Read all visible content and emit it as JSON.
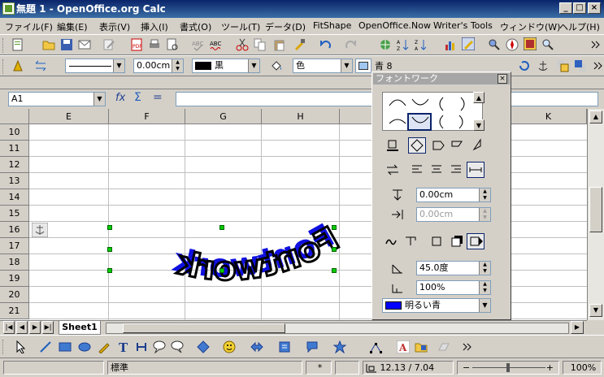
{
  "window": {
    "title": "無題 1 - OpenOffice.org Calc"
  },
  "menu": [
    "ファイル(F)",
    "編集(E)",
    "表示(V)",
    "挿入(I)",
    "書式(O)",
    "ツール(T)",
    "データ(D)",
    "FitShape",
    "OpenOffice.Now",
    "Writer's Tools",
    "ウィンドウ(W)",
    "ヘルプ(H)"
  ],
  "format_toolbar": {
    "line_width": "0.00cm",
    "line_color": "黒",
    "area_mode": "色",
    "area_color": "青 8"
  },
  "formula_bar": {
    "name_box": "A1",
    "input_value": ""
  },
  "sheet": {
    "columns": [
      "E",
      "F",
      "G",
      "H",
      "K"
    ],
    "rows": [
      "10",
      "11",
      "12",
      "13",
      "14",
      "15",
      "16",
      "17",
      "18",
      "19",
      "20",
      "21"
    ],
    "tab": "Sheet1",
    "fontwork_text": "Fontwork"
  },
  "fontwork_panel": {
    "title": "フォントワーク",
    "distance": "0.00cm",
    "indent": "0.00cm",
    "shadow_angle": "45.0度",
    "shadow_size": "100%",
    "shadow_color": "明るい青",
    "shadow_color_hex": "#0000ff"
  },
  "status": {
    "style": "標準",
    "mode": "*",
    "position": "12.13 / 7.04",
    "zoom": "100%"
  }
}
